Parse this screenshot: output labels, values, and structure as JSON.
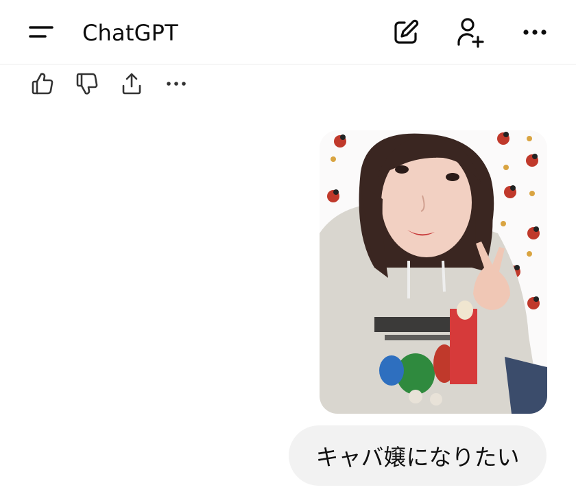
{
  "header": {
    "title": "ChatGPT",
    "icons": {
      "menu": "menu-icon",
      "new_chat": "new-chat-icon",
      "add_people": "add-person-icon",
      "more": "more-icon"
    }
  },
  "message_actions": {
    "icons": [
      "thumbs-up-icon",
      "thumbs-down-icon",
      "share-icon",
      "more-icon"
    ]
  },
  "user_message": {
    "image": "uploaded-photo",
    "text": "キャバ嬢になりたい"
  },
  "colors": {
    "background": "#ffffff",
    "bubble": "#f2f2f2",
    "text": "#0d0d0d",
    "divider": "#ececec"
  }
}
